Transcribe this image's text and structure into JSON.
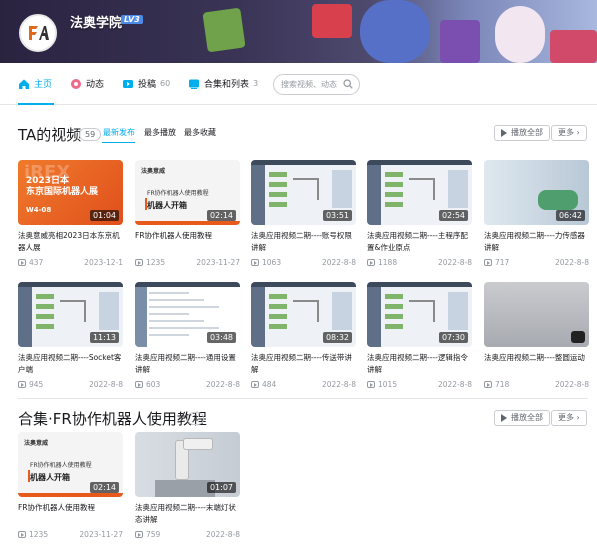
{
  "header": {
    "username": "法奥学院",
    "level": "LV3"
  },
  "nav": {
    "items": [
      {
        "label": "主页",
        "count": ""
      },
      {
        "label": "动态",
        "count": ""
      },
      {
        "label": "投稿",
        "count": "60"
      },
      {
        "label": "合集和列表",
        "count": "3"
      }
    ],
    "search_placeholder": "搜索视频、动态"
  },
  "videos_section": {
    "title": "TA的视频",
    "count": "59",
    "sorts": [
      "最新发布",
      "最多播放",
      "最多收藏"
    ],
    "play_all": "播放全部",
    "more": "更多"
  },
  "videos": [
    {
      "title": "法奥意威亮相2023日本东京机器人展",
      "plays": "437",
      "date": "2023-12-1",
      "duration": "01:04",
      "thumb": "orange",
      "thumb_text": [
        "2023日本",
        "东京国际机器人展"
      ],
      "thumb_date": "W4-08",
      "thumb_ghost": "iREX"
    },
    {
      "title": "FR协作机器人使用教程",
      "plays": "1235",
      "date": "2023-11-27",
      "duration": "02:14",
      "thumb": "doc",
      "thumb_logo": "法奥意威",
      "thumb_l1": "FR协作机器人使用教程",
      "thumb_l2": "机器人开箱"
    },
    {
      "title": "法奥应用视频二期----账号权限讲解",
      "plays": "1063",
      "date": "2022-8-8",
      "duration": "03:51",
      "thumb": "sw"
    },
    {
      "title": "法奥应用视频二期----主程序配置&作业原点",
      "plays": "1188",
      "date": "2022-8-8",
      "duration": "02:54",
      "thumb": "sw"
    },
    {
      "title": "法奥应用视频二期----力传感器讲解",
      "plays": "717",
      "date": "2022-8-8",
      "duration": "06:42",
      "thumb": "green"
    },
    {
      "title": "法奥应用视频二期----Socket客户端",
      "plays": "945",
      "date": "2022-8-8",
      "duration": "11:13",
      "thumb": "sw"
    },
    {
      "title": "法奥应用视频二期----通用设置讲解",
      "plays": "603",
      "date": "2022-8-8",
      "duration": "03:48",
      "thumb": "list"
    },
    {
      "title": "法奥应用视频二期----传送带讲解",
      "plays": "484",
      "date": "2022-8-8",
      "duration": "08:32",
      "thumb": "sw"
    },
    {
      "title": "法奥应用视频二期----逻辑指令讲解",
      "plays": "1015",
      "date": "2022-8-8",
      "duration": "07:30",
      "thumb": "sw"
    },
    {
      "title": "法奥应用视频二期----整圆运动",
      "plays": "718",
      "date": "2022-8-8",
      "duration": "",
      "thumb": "grey"
    }
  ],
  "collection": {
    "title": "合集·FR协作机器人使用教程",
    "count": "2",
    "play_all": "播放全部",
    "more": "更多",
    "videos": [
      {
        "title": "FR协作机器人使用教程",
        "plays": "1235",
        "date": "2023-11-27",
        "duration": "02:14",
        "thumb": "doc",
        "thumb_logo": "法奥意威",
        "thumb_l1": "FR协作机器人使用教程",
        "thumb_l2": "机器人开箱"
      },
      {
        "title": "法奥应用视频二期----末端灯状态讲解",
        "plays": "759",
        "date": "2022-8-8",
        "duration": "01:07",
        "thumb": "arm"
      }
    ]
  },
  "colors": {
    "accent": "#00aeec",
    "text": "#18191c",
    "muted": "#9499a0",
    "level_badge": "#4c8ce6"
  }
}
